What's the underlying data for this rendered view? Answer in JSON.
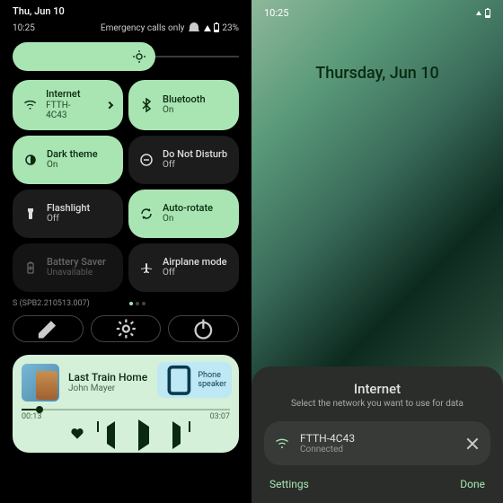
{
  "colors": {
    "accent": "#a9e5b3",
    "on_text": "#0a2a10"
  },
  "left": {
    "date": "Thu, Jun 10",
    "clock": "10:25",
    "emergency": "Emergency calls only",
    "battery": "23%",
    "brightness_pct": 63,
    "tiles": {
      "internet": {
        "title": "Internet",
        "sub": "FTTH-4C43",
        "state": "on",
        "icon": "wifi"
      },
      "bluetooth": {
        "title": "Bluetooth",
        "sub": "On",
        "state": "on",
        "icon": "bluetooth"
      },
      "darktheme": {
        "title": "Dark theme",
        "sub": "On",
        "state": "on",
        "icon": "darktheme"
      },
      "dnd": {
        "title": "Do Not Disturb",
        "sub": "Off",
        "state": "off",
        "icon": "dnd"
      },
      "flashlight": {
        "title": "Flashlight",
        "sub": "Off",
        "state": "off",
        "icon": "flashlight"
      },
      "autorotate": {
        "title": "Auto-rotate",
        "sub": "On",
        "state": "on",
        "icon": "rotate"
      },
      "battsaver": {
        "title": "Battery Saver",
        "sub": "Unavailable",
        "state": "dis",
        "icon": "battsaver"
      },
      "airplane": {
        "title": "Airplane mode",
        "sub": "Off",
        "state": "off",
        "icon": "airplane"
      }
    },
    "build": "S (SPB2.210513.007)",
    "media": {
      "output": "Phone speaker",
      "track": "Last Train Home",
      "artist": "John Mayer",
      "elapsed": "00:13",
      "duration": "03:07",
      "progress_pct": 7
    }
  },
  "right": {
    "clock": "10:25",
    "date": "Thursday, Jun 10",
    "sheet": {
      "title": "Internet",
      "subtitle": "Select the network you want to use for data",
      "network": {
        "name": "FTTH-4C43",
        "status": "Connected"
      },
      "settings": "Settings",
      "done": "Done"
    }
  }
}
